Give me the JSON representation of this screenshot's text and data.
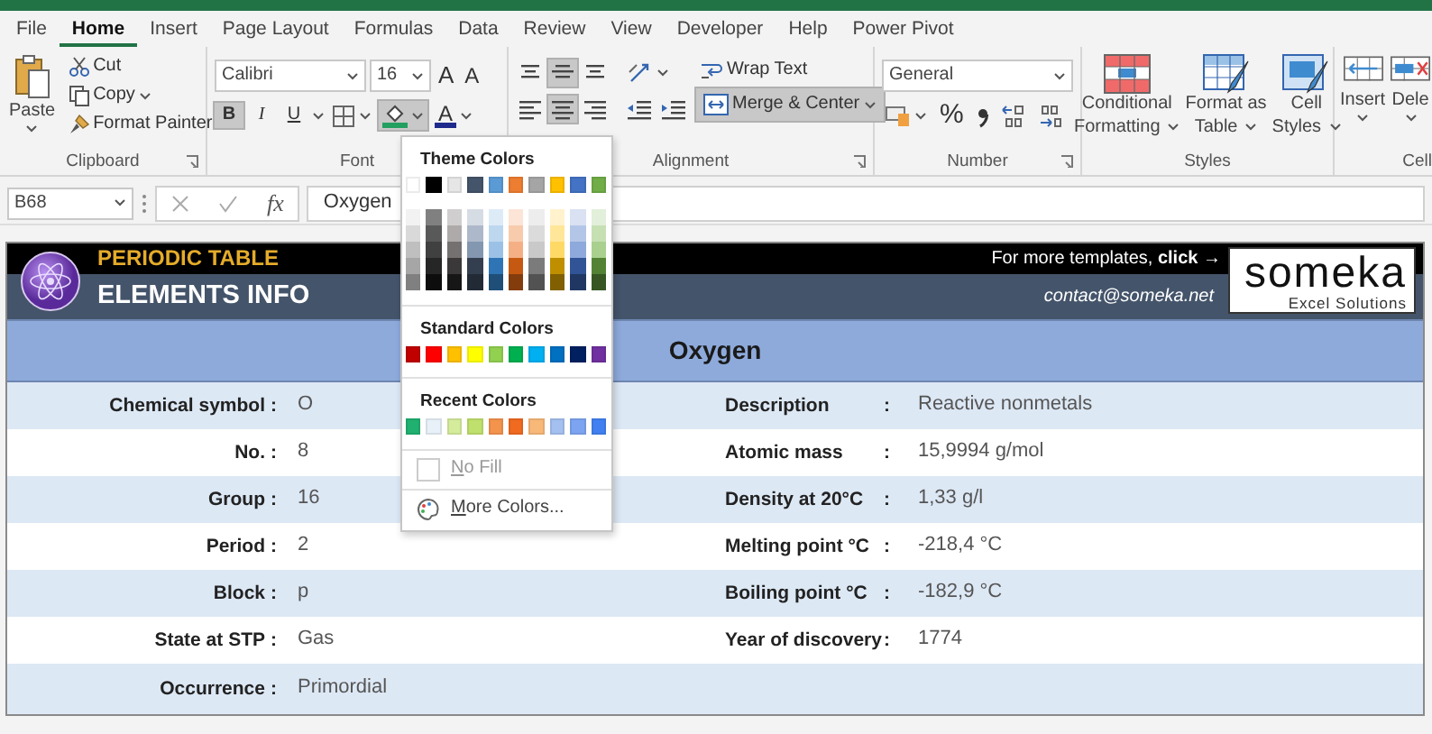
{
  "tabs": [
    {
      "label": "File",
      "selected": false
    },
    {
      "label": "Home",
      "selected": true
    },
    {
      "label": "Insert",
      "selected": false
    },
    {
      "label": "Page Layout",
      "selected": false
    },
    {
      "label": "Formulas",
      "selected": false
    },
    {
      "label": "Data",
      "selected": false
    },
    {
      "label": "Review",
      "selected": false
    },
    {
      "label": "View",
      "selected": false
    },
    {
      "label": "Developer",
      "selected": false
    },
    {
      "label": "Help",
      "selected": false
    },
    {
      "label": "Power Pivot",
      "selected": false
    }
  ],
  "clipboard": {
    "paste": "Paste",
    "cut": "Cut",
    "copy": "Copy",
    "format_painter": "Format Painter",
    "label": "Clipboard"
  },
  "font": {
    "name": "Calibri",
    "size": "16",
    "grow": "A",
    "shrink": "A",
    "styles": [
      {
        "label": "B",
        "on": true
      },
      {
        "label": "I",
        "on": false
      },
      {
        "label": "U",
        "on": false
      }
    ],
    "font_color": "A",
    "fill_open": true,
    "label": "Font"
  },
  "alignment": {
    "vertical": [
      {
        "kind": "top",
        "on": false
      },
      {
        "kind": "middle",
        "on": true
      },
      {
        "kind": "bottom",
        "on": false
      }
    ],
    "horizontal": [
      {
        "kind": "left",
        "on": false
      },
      {
        "kind": "center",
        "on": true
      },
      {
        "kind": "right",
        "on": false
      }
    ],
    "wrap_text": "Wrap Text",
    "merge": {
      "label": "Merge & Center",
      "on": true
    },
    "label": "Alignment"
  },
  "number": {
    "format": "General",
    "percent": "%",
    "label": "Number"
  },
  "styles": {
    "buttons": [
      {
        "kind": "conditional",
        "label": "Conditional",
        "sublabel": "Formatting"
      },
      {
        "kind": "table",
        "label": "Format as",
        "sublabel": "Table"
      },
      {
        "kind": "cell",
        "label": "Cell",
        "sublabel": "Styles"
      }
    ],
    "label": "Styles"
  },
  "cells": {
    "buttons": [
      {
        "kind": "insert",
        "label": "Insert"
      },
      {
        "kind": "delete",
        "label": "Dele"
      }
    ],
    "label": "Cell"
  },
  "formula_bar": {
    "cell": "B68",
    "fx": "fx",
    "value": "Oxygen"
  },
  "sheet": {
    "kicker": "PERIODIC TABLE",
    "title": "ELEMENTS INFO",
    "promo": "For more templates, **click** →",
    "contact": "contact@someka.net",
    "brand": "someka",
    "brand_tagline": "Excel Solutions",
    "element": "Oxygen",
    "left_rows": [
      {
        "label": "Chemical symbol",
        "colon": ":",
        "value": "O"
      },
      {
        "label": "No.",
        "colon": ":",
        "value": "8"
      },
      {
        "label": "Group",
        "colon": ":",
        "value": "16"
      },
      {
        "label": "Period",
        "colon": ":",
        "value": "2"
      },
      {
        "label": "Block",
        "colon": ":",
        "value": "p"
      },
      {
        "label": "State at STP",
        "colon": ":",
        "value": "Gas"
      },
      {
        "label": "Occurrence",
        "colon": ":",
        "value": "Primordial"
      }
    ],
    "right_rows": [
      {
        "label": "Description",
        "colon": ":",
        "value": "Reactive nonmetals"
      },
      {
        "label": "Atomic mass",
        "colon": ":",
        "value": "15,9994 g/mol"
      },
      {
        "label": "Density at 20°C",
        "colon": ":",
        "value": "1,33 g/l"
      },
      {
        "label": "Melting point °C",
        "colon": ":",
        "value": "-218,4 °C"
      },
      {
        "label": "Boiling point °C",
        "colon": ":",
        "value": "-182,9 °C"
      },
      {
        "label": "Year of discovery",
        "colon": ":",
        "value": "1774"
      }
    ]
  },
  "fill_menu": {
    "theme_heading": "Theme Colors",
    "theme_colors": [
      {
        "color": "#ffffff",
        "shades": [
          {
            "color": "#f2f2f2"
          },
          {
            "color": "#d9d9d9"
          },
          {
            "color": "#bfbfbf"
          },
          {
            "color": "#a6a6a6"
          },
          {
            "color": "#808080"
          }
        ]
      },
      {
        "color": "#000000",
        "shades": [
          {
            "color": "#808080"
          },
          {
            "color": "#595959"
          },
          {
            "color": "#404040"
          },
          {
            "color": "#262626"
          },
          {
            "color": "#0d0d0d"
          }
        ]
      },
      {
        "color": "#e7e6e6",
        "shades": [
          {
            "color": "#d0cece"
          },
          {
            "color": "#aeaaaa"
          },
          {
            "color": "#757171"
          },
          {
            "color": "#3a3838"
          },
          {
            "color": "#171616"
          }
        ]
      },
      {
        "color": "#44546a",
        "shades": [
          {
            "color": "#d6dce4"
          },
          {
            "color": "#adb9ca"
          },
          {
            "color": "#8497b0"
          },
          {
            "color": "#333f4f"
          },
          {
            "color": "#222a35"
          }
        ]
      },
      {
        "color": "#5b9bd5",
        "shades": [
          {
            "color": "#ddebf7"
          },
          {
            "color": "#bdd7ee"
          },
          {
            "color": "#9bc2e6"
          },
          {
            "color": "#2f75b5"
          },
          {
            "color": "#1f4e78"
          }
        ]
      },
      {
        "color": "#ed7d31",
        "shades": [
          {
            "color": "#fce4d6"
          },
          {
            "color": "#f8cbad"
          },
          {
            "color": "#f4b084"
          },
          {
            "color": "#c65911"
          },
          {
            "color": "#833c0c"
          }
        ]
      },
      {
        "color": "#a5a5a5",
        "shades": [
          {
            "color": "#ededed"
          },
          {
            "color": "#dbdbdb"
          },
          {
            "color": "#c9c9c9"
          },
          {
            "color": "#7b7b7b"
          },
          {
            "color": "#525252"
          }
        ]
      },
      {
        "color": "#ffc000",
        "shades": [
          {
            "color": "#fff2cc"
          },
          {
            "color": "#ffe699"
          },
          {
            "color": "#ffd966"
          },
          {
            "color": "#bf8f00"
          },
          {
            "color": "#806000"
          }
        ]
      },
      {
        "color": "#4472c4",
        "shades": [
          {
            "color": "#d9e1f2"
          },
          {
            "color": "#b4c6e7"
          },
          {
            "color": "#8ea9db"
          },
          {
            "color": "#305496"
          },
          {
            "color": "#203764"
          }
        ]
      },
      {
        "color": "#70ad47",
        "shades": [
          {
            "color": "#e2efda"
          },
          {
            "color": "#c6e0b4"
          },
          {
            "color": "#a9d08e"
          },
          {
            "color": "#548235"
          },
          {
            "color": "#375623"
          }
        ]
      }
    ],
    "standard_heading": "Standard Colors",
    "standard_colors": [
      {
        "color": "#c00000"
      },
      {
        "color": "#ff0000"
      },
      {
        "color": "#ffc000"
      },
      {
        "color": "#ffff00"
      },
      {
        "color": "#92d050"
      },
      {
        "color": "#00b050"
      },
      {
        "color": "#00b0f0"
      },
      {
        "color": "#0070c0"
      },
      {
        "color": "#002060"
      },
      {
        "color": "#7030a0"
      }
    ],
    "recent_heading": "Recent Colors",
    "recent_colors": [
      {
        "color": "#20b070"
      },
      {
        "color": "#e8f0f8"
      },
      {
        "color": "#d4ec9c"
      },
      {
        "color": "#bfe06c"
      },
      {
        "color": "#f4934c"
      },
      {
        "color": "#f06a20"
      },
      {
        "color": "#f8b878"
      },
      {
        "color": "#a4c0f0"
      },
      {
        "color": "#7ca4f0"
      },
      {
        "color": "#4080f0"
      }
    ],
    "no_fill": {
      "label": "No Fill",
      "disabled": true
    },
    "more_colors": "More Colors..."
  }
}
